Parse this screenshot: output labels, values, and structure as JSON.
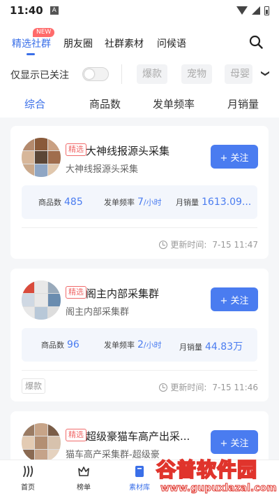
{
  "status_bar": {
    "time": "11:40",
    "notif_glyph": "A"
  },
  "top_tabs": {
    "items": [
      {
        "label": "精选社群",
        "active": true
      },
      {
        "label": "朋友圈",
        "active": false
      },
      {
        "label": "社群素材",
        "active": false
      },
      {
        "label": "问候语",
        "active": false
      }
    ],
    "new_badge": "NEW"
  },
  "filter": {
    "follow_only_label": "仅显示已关注",
    "toggle_on": false,
    "chips": [
      "爆款",
      "宠物",
      "母婴"
    ],
    "more_glyph": "❯"
  },
  "sort": {
    "tabs": [
      "综合",
      "商品数",
      "发单频率",
      "月销量"
    ],
    "active_index": 0
  },
  "cards": [
    {
      "tag": "精选",
      "title": "大神线报源头采集",
      "subtitle": "大神线报源头采集",
      "follow_label": "+ 关注",
      "stats": {
        "goods_label": "商品数",
        "goods_value": "485",
        "freq_label": "发单频率",
        "freq_value": "7",
        "freq_unit": "/小时",
        "sales_label": "月销量",
        "sales_value": "1613.09..."
      },
      "update_label": "更新时间:",
      "update_time": "7-15 11:47",
      "bottom_tag": ""
    },
    {
      "tag": "精选",
      "title": "阁主内部采集群",
      "subtitle": "阁主内部采集群",
      "follow_label": "+ 关注",
      "stats": {
        "goods_label": "商品数",
        "goods_value": "96",
        "freq_label": "发单频率",
        "freq_value": "2",
        "freq_unit": "/小时",
        "sales_label": "月销量",
        "sales_value": "44.83万"
      },
      "update_label": "更新时间:",
      "update_time": "7-15 11:46",
      "bottom_tag": "爆款"
    },
    {
      "tag": "精选",
      "title": "超级豪猫车高产出采...",
      "subtitle": "猫车高产采集群-超级豪",
      "follow_label": "+ 关注"
    }
  ],
  "bottom_nav": [
    {
      "label": "首页",
      "icon": "home-icon",
      "active": false
    },
    {
      "label": "榜单",
      "icon": "crown-icon",
      "active": false
    },
    {
      "label": "素材库",
      "icon": "material-icon",
      "active": true
    }
  ],
  "watermark": {
    "title": "谷普软件园",
    "url": "www.gupuxlazal.com"
  },
  "colors": {
    "accent": "#3a6fe8",
    "button": "#4a7cf0",
    "tag": "#f06a6a",
    "badge": "#ff6b6b"
  }
}
